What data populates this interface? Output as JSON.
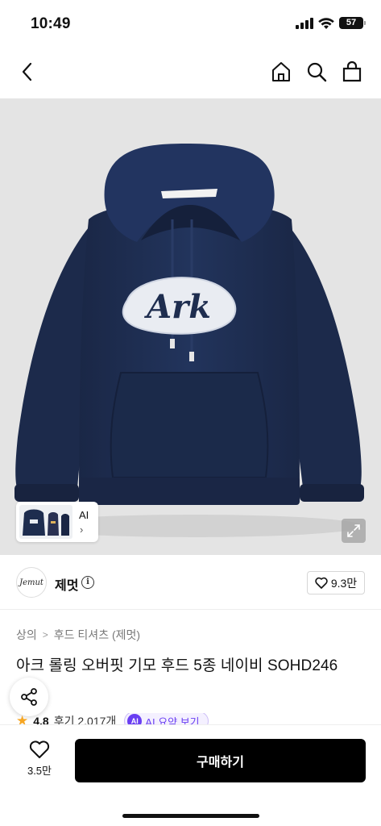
{
  "status_bar": {
    "time": "10:49",
    "battery": "57"
  },
  "nav": {
    "back_icon": "chevron-left-icon",
    "home_icon": "home-icon",
    "search_icon": "search-icon",
    "cart_icon": "shopping-bag-icon"
  },
  "hero": {
    "thumbnail_label": "AI",
    "thumbnail_chevron": "›",
    "expand_icon": "expand-icon",
    "hoodie_color": "#1e2d4f",
    "print_text": "Ark"
  },
  "brand": {
    "logo_text": "Jemut",
    "name": "제멋",
    "likes": "9.3만"
  },
  "breadcrumb": {
    "items": [
      "상의",
      "후드 티셔츠 (제멋)"
    ],
    "separator": ">"
  },
  "product": {
    "title": "아크 롤링 오버핏 기모 후드 5종 네이비 SOHD246"
  },
  "rating": {
    "score": "4.8",
    "reviews": "후기 2,017개",
    "ai_badge": "AI",
    "ai_summary": "AI 요약 보기"
  },
  "bottom": {
    "wish_count": "3.5만",
    "buy_label": "구매하기"
  },
  "colors": {
    "accent": "#6a3ff2",
    "star": "#f6a623",
    "buy_bg": "#000000"
  }
}
